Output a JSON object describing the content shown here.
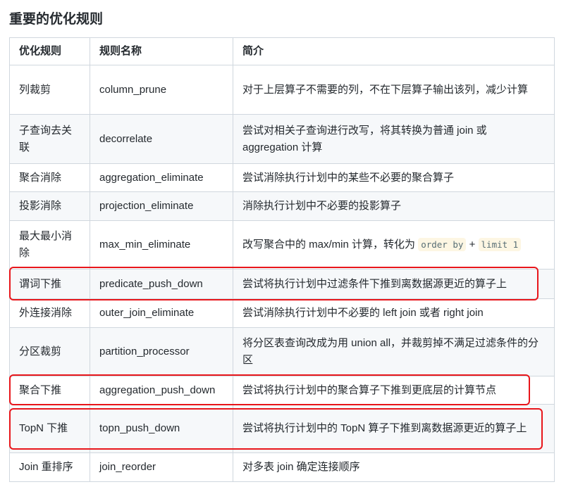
{
  "title": "重要的优化规则",
  "headers": [
    "优化规则",
    "规则名称",
    "简介"
  ],
  "rows": [
    {
      "rule": "列裁剪",
      "name": "column_prune",
      "desc": "对于上层算子不需要的列，不在下层算子输出该列，减少计算"
    },
    {
      "rule": "子查询去关联",
      "name": "decorrelate",
      "desc": "尝试对相关子查询进行改写，将其转换为普通 join 或 aggregation 计算"
    },
    {
      "rule": "聚合消除",
      "name": "aggregation_eliminate",
      "desc": "尝试消除执行计划中的某些不必要的聚合算子"
    },
    {
      "rule": "投影消除",
      "name": "projection_eliminate",
      "desc": "消除执行计划中不必要的投影算子"
    },
    {
      "rule": "最大最小消除",
      "name": "max_min_eliminate",
      "desc": "改写聚合中的 max/min 计算，转化为",
      "code1": "order by",
      "plus": "+",
      "code2": "limit 1"
    },
    {
      "rule": "谓词下推",
      "name": "predicate_push_down",
      "desc": "尝试将执行计划中过滤条件下推到离数据源更近的算子上",
      "highlighted": true
    },
    {
      "rule": "外连接消除",
      "name": "outer_join_eliminate",
      "desc": "尝试消除执行计划中不必要的 left join 或者 right join"
    },
    {
      "rule": "分区裁剪",
      "name": "partition_processor",
      "desc": "将分区表查询改成为用 union all，并裁剪掉不满足过滤条件的分区"
    },
    {
      "rule": "聚合下推",
      "name": "aggregation_push_down",
      "desc": "尝试将执行计划中的聚合算子下推到更底层的计算节点",
      "highlighted": true
    },
    {
      "rule": "TopN 下推",
      "name": "topn_push_down",
      "desc": "尝试将执行计划中的 TopN 算子下推到离数据源更近的算子上",
      "highlighted": true
    },
    {
      "rule": "Join 重排序",
      "name": "join_reorder",
      "desc": "对多表 join 确定连接顺序"
    }
  ],
  "highlight_color": "#e8161b"
}
